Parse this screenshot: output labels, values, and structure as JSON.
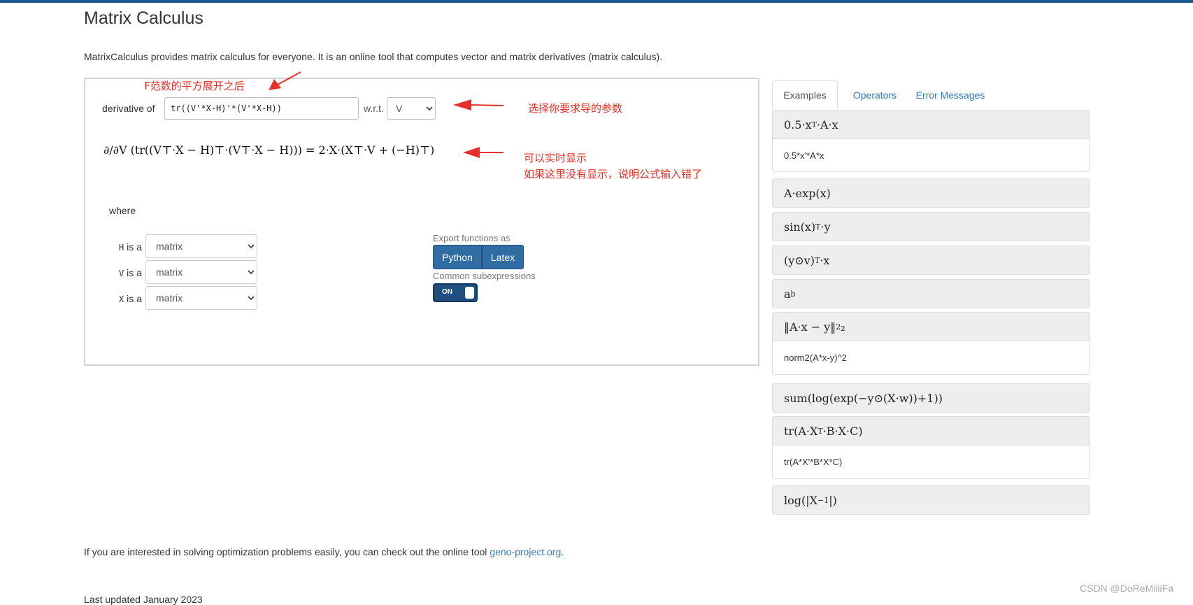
{
  "page": {
    "title": "Matrix Calculus",
    "intro": "MatrixCalculus provides matrix calculus for everyone. It is an online tool that computes vector and matrix derivatives (matrix calculus)."
  },
  "calculator": {
    "derivative_label": "derivative of",
    "expression": "tr((V'*X-H)'*(V'*X-H))",
    "wrt_label": "w.r.t.",
    "wrt_value": "V",
    "result_formula": "∂/∂V (tr((V⊤·X − H)⊤·(V⊤·X − H))) = 2·X·(X⊤·V + (−H)⊤)",
    "where_label": "where",
    "variables": [
      {
        "name": "H",
        "suffix": "is a",
        "type": "matrix"
      },
      {
        "name": "V",
        "suffix": "is a",
        "type": "matrix"
      },
      {
        "name": "X",
        "suffix": "is a",
        "type": "matrix"
      }
    ],
    "export_label": "Export functions as",
    "export_buttons": {
      "python": "Python",
      "latex": "Latex"
    },
    "common_label": "Common subexpressions",
    "toggle_state": "ON"
  },
  "annotations": {
    "norm_note": "F范数的平方展开之后",
    "param_note": "选择你要求导的参数",
    "realtime_note": "可以实时显示",
    "error_note": "如果这里没有显示，说明公式输入错了"
  },
  "tabs": {
    "examples": "Examples",
    "operators": "Operators",
    "errors": "Error Messages"
  },
  "examples": [
    {
      "formula": "0.5·x",
      "sup": "T",
      "formula_rest": "·A·x",
      "body": "0.5*x'*A*x"
    },
    {
      "formula": "A·exp(x)",
      "sup": "",
      "formula_rest": "",
      "body": ""
    },
    {
      "formula": "sin(x)",
      "sup": "T",
      "formula_rest": "·y",
      "body": ""
    },
    {
      "formula": "(y⊙v)",
      "sup": "T",
      "formula_rest": "·x",
      "body": ""
    },
    {
      "formula": "a",
      "sup": "b",
      "formula_rest": "",
      "body": ""
    },
    {
      "formula": "‖A·x − y‖",
      "sup": "2",
      "formula_rest": "₂",
      "body": "norm2(A*x-y)^2"
    },
    {
      "formula": "sum(log(exp(−y⊙(X·w))+1))",
      "sup": "",
      "formula_rest": "",
      "body": ""
    },
    {
      "formula": "tr(A·X",
      "sup": "T",
      "formula_rest": "·B·X·C)",
      "body": "tr(A*X'*B*X*C)"
    },
    {
      "formula": "log(|X",
      "sup": "−1",
      "formula_rest": "|)",
      "body": ""
    }
  ],
  "footer": {
    "text": "If you are interested in solving optimization problems easily, you can check out the online tool ",
    "link": "geno-project.org",
    "period": ".",
    "last_updated": "Last updated January 2023"
  },
  "watermark": "CSDN @DoReMiiiiFa"
}
